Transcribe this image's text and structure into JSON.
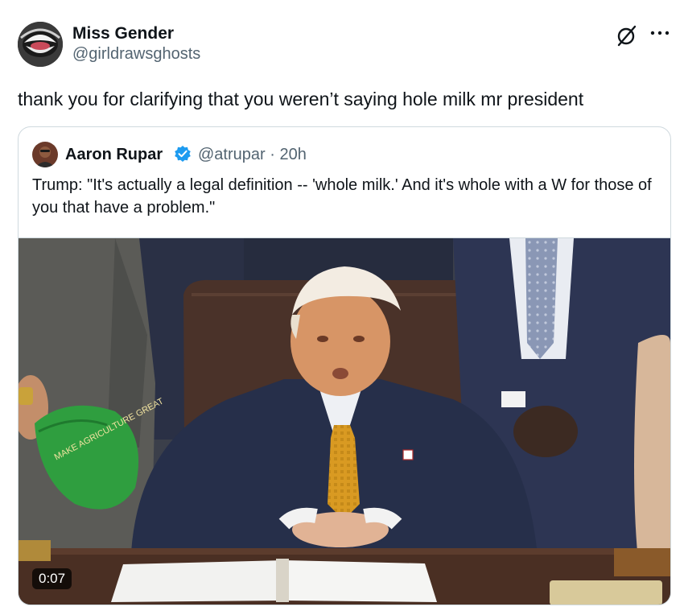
{
  "post": {
    "author_name": "Miss Gender",
    "author_handle": "@girldrawsghosts",
    "text": "thank you for clarifying that you weren’t saying hole milk mr president",
    "icons": {
      "avatar": "laughing-mouth-avatar",
      "grok": "grok-slash-icon",
      "more": "more-dots-icon"
    }
  },
  "quote": {
    "author_name": "Aaron Rupar",
    "author_handle": "@atrupar · 20h",
    "verified": true,
    "text": "Trump: \"It's actually a legal definition -- 'whole milk.' And it's whole with a W for those of you that have a problem.\"",
    "video": {
      "timestamp": "0:07",
      "cap_text": "MAKE AGRICULTURE GREAT"
    }
  },
  "colors": {
    "text_primary": "#0f1419",
    "text_secondary": "#536471",
    "border": "#cfd9de",
    "verified_blue": "#1d9bf0",
    "tie_gold": "#d99a22",
    "cap_green": "#2f9e3f"
  }
}
